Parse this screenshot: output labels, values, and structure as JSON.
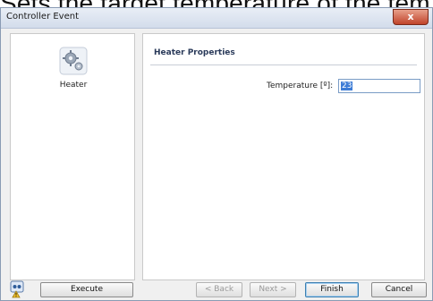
{
  "overlay_text": "Sets the target temperature of the tem",
  "window": {
    "title": "Controller Event",
    "close_glyph": "x"
  },
  "tree": {
    "items": [
      {
        "label": "Heater",
        "icon": "gears-icon"
      }
    ]
  },
  "properties": {
    "section_title": "Heater Properties",
    "temperature_label": "Temperature [º]:",
    "temperature_value": "23"
  },
  "footer": {
    "status_icon": "warning-robot-icon",
    "execute_label": "Execute",
    "back_label": "< Back",
    "next_label": "Next >",
    "finish_label": "Finish",
    "cancel_label": "Cancel"
  },
  "colors": {
    "selection": "#3d7cd6",
    "close_button": "#c0432a",
    "section_title": "#2a3a5a"
  }
}
